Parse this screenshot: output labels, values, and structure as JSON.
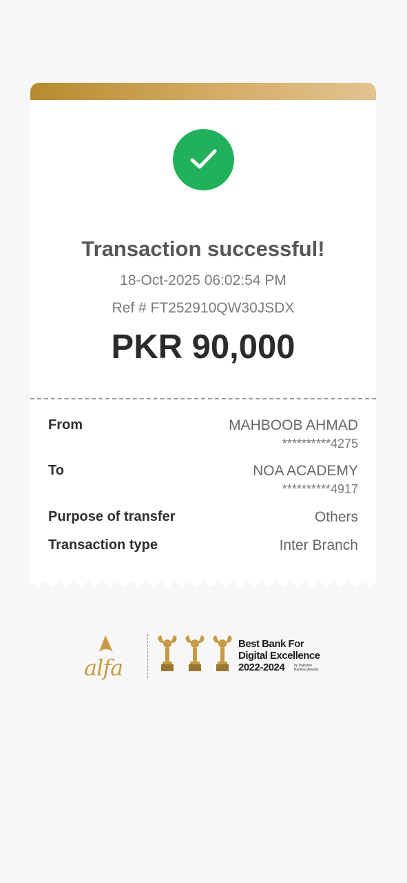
{
  "receipt": {
    "title": "Transaction successful!",
    "datetime": "18-Oct-2025 06:02:54 PM",
    "ref": "Ref # FT252910QW30JSDX",
    "amount": "PKR 90,000",
    "status_icon": "check-icon",
    "status_color": "#21b15a",
    "accent_color": "#c99a45"
  },
  "details": {
    "from_label": "From",
    "from_name": "MAHBOOB AHMAD",
    "from_account": "**********4275",
    "to_label": "To",
    "to_name": "NOA ACADEMY",
    "to_account": "**********4917",
    "purpose_label": "Purpose of transfer",
    "purpose_value": "Others",
    "type_label": "Transaction type",
    "type_value": "Inter Branch"
  },
  "footer": {
    "logo_text": "alfa",
    "award_line1": "Best Bank For",
    "award_line2": "Digital Excellence",
    "award_line3": "2022-2024",
    "award_small1": "by Pakistan",
    "award_small2": "Banking Awards",
    "trophy_icon": "trophy-icon"
  }
}
